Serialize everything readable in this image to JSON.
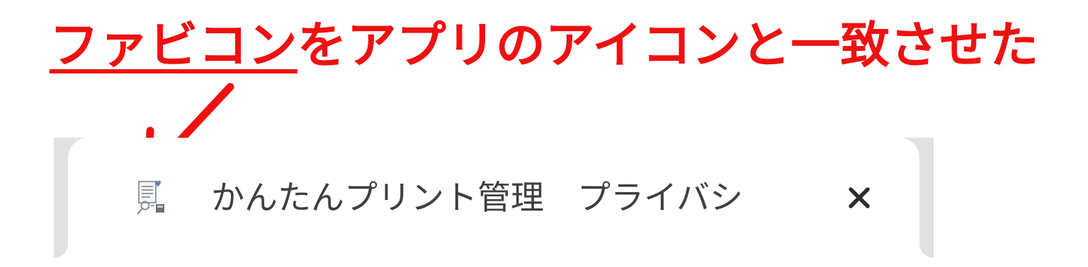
{
  "annotation": {
    "headline_underlined": "ファビコン",
    "headline_rest": "をアプリのアイコンと一致させた",
    "color": "#ee1111"
  },
  "arrow": {
    "color": "#ee1111",
    "icon": "arrow-down-left-icon"
  },
  "browser_tab": {
    "title": "かんたんプリント管理　プライバシ",
    "favicon_icon": "document-search-favicon-icon",
    "close_icon": "close-icon",
    "active_background": "#ffffff",
    "strip_background": "#dfe1e5",
    "text_color": "#3c4043"
  }
}
